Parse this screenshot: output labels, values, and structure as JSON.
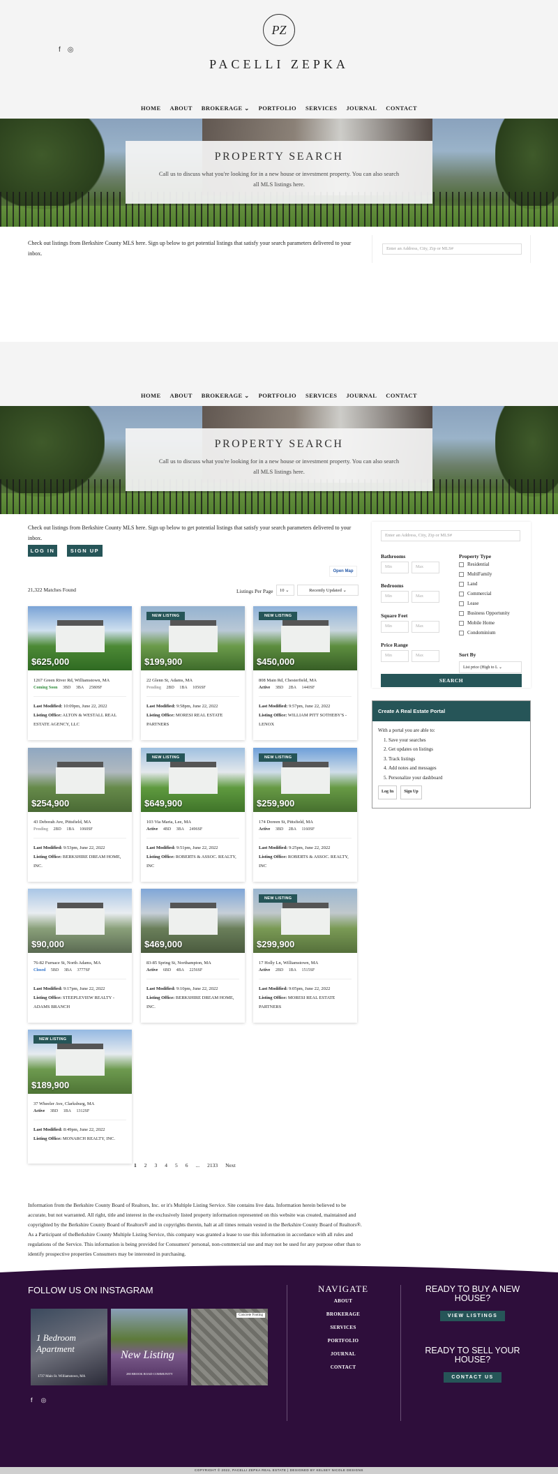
{
  "brand": {
    "logo_monogram": "PZ",
    "name": "PACELLI ZEPKA"
  },
  "social": {
    "facebook": "f",
    "instagram": "◎"
  },
  "nav": [
    "HOME",
    "ABOUT",
    "BROKERAGE ⌄",
    "PORTFOLIO",
    "SERVICES",
    "JOURNAL",
    "CONTACT"
  ],
  "hero": {
    "title": "PROPERTY SEARCH",
    "description": "Call us to discuss what you're looking for in a new house or investment property. You can also search all MLS listings here."
  },
  "intro": "Check out listings from Berkshire County MLS here. Sign up below to get potential listings that satisfy your search parameters delivered to your inbox.",
  "search": {
    "address_placeholder": "Enter an Address, City, Zip or MLS#",
    "bathrooms_label": "Bathrooms",
    "bedrooms_label": "Bedrooms",
    "sqft_label": "Square Feet",
    "price_label": "Price Range",
    "min": "Min",
    "max": "Max",
    "property_type_label": "Property Type",
    "property_types": [
      "Residential",
      "MultiFamily",
      "Land",
      "Commercial",
      "Lease",
      "Business Opportunity",
      "Mobile Home",
      "Condominium"
    ],
    "sort_by_label": "Sort By",
    "sort_by_value": "List price (High to L",
    "search_button": "SEARCH"
  },
  "auth": {
    "login": "LOG IN",
    "signup": "SIGN UP"
  },
  "results": {
    "open_map": "Open Map",
    "matches": "21,322 Matches Found",
    "per_page_label": "Listings Per Page",
    "per_page_value": "10",
    "sort_value": "Recently Updated"
  },
  "listings": [
    {
      "badge": "",
      "price": "$625,000",
      "address": "1267 Green River Rd, Williamstown, MA",
      "status": "Coming Soon",
      "status_color": "#2e8b3a",
      "bd": "3BD",
      "ba": "3BA",
      "sf": "2580SF",
      "modified": "10:09pm, June 22, 2022",
      "office": "ALTON & WESTALL REAL ESTATE AGENCY, LLC"
    },
    {
      "badge": "NEW LISTING",
      "price": "$199,900",
      "address": "22 Glenn St, Adams, MA",
      "status": "Pending",
      "status_color": "#999999",
      "bd": "2BD",
      "ba": "1BA",
      "sf": "1056SF",
      "modified": "9:58pm, June 22, 2022",
      "office": "MORESI REAL ESTATE PARTNERS"
    },
    {
      "badge": "NEW LISTING",
      "price": "$450,000",
      "address": "808 Main Rd, Chesterfield, MA",
      "status": "Active",
      "status_color": "#222222",
      "bd": "3BD",
      "ba": "2BA",
      "sf": "1440SF",
      "modified": "9:57pm, June 22, 2022",
      "office": "WILLIAM PITT SOTHEBY'S - LENOX"
    },
    {
      "badge": "",
      "price": "$254,900",
      "address": "43 Deborah Ave, Pittsfield, MA",
      "status": "Pending",
      "status_color": "#999999",
      "bd": "2BD",
      "ba": "1BA",
      "sf": "1060SF",
      "modified": "9:53pm, June 22, 2022",
      "office": "BERKSHIRE DREAM HOME, INC."
    },
    {
      "badge": "NEW LISTING",
      "price": "$649,900",
      "address": "103 Via Maria, Lee, MA",
      "status": "Active",
      "status_color": "#222222",
      "bd": "4BD",
      "ba": "3BA",
      "sf": "2496SF",
      "modified": "9:51pm, June 22, 2022",
      "office": "ROBERTS & ASSOC. REALTY, INC"
    },
    {
      "badge": "NEW LISTING",
      "price": "$259,900",
      "address": "174 Doreen St, Pittsfield, MA",
      "status": "Active",
      "status_color": "#222222",
      "bd": "3BD",
      "ba": "2BA",
      "sf": "1160SF",
      "modified": "9:25pm, June 22, 2022",
      "office": "ROBERTS & ASSOC. REALTY, INC"
    },
    {
      "badge": "",
      "price": "$90,000",
      "address": "76-82 Furnace St, North Adams, MA",
      "status": "Closed",
      "status_color": "#2a6fc9",
      "bd": "5BD",
      "ba": "3BA",
      "sf": "3777SF",
      "modified": "9:17pm, June 22, 2022",
      "office": "STEEPLEVIEW REALTY - ADAMS BRANCH"
    },
    {
      "badge": "",
      "price": "$469,000",
      "address": "83-85 Spring St, Northampton, MA",
      "status": "Active",
      "status_color": "#222222",
      "bd": "6BD",
      "ba": "4BA",
      "sf": "2256SF",
      "modified": "9:10pm, June 22, 2022",
      "office": "BERKSHIRE DREAM HOME, INC."
    },
    {
      "badge": "NEW LISTING",
      "price": "$299,900",
      "address": "17 Holly Ln, Williamstown, MA",
      "status": "Active",
      "status_color": "#222222",
      "bd": "2BD",
      "ba": "1BA",
      "sf": "1515SF",
      "modified": "9:05pm, June 22, 2022",
      "office": "MORESI REAL ESTATE PARTNERS"
    },
    {
      "badge": "NEW LISTING",
      "price": "$189,900",
      "address": "37 Wheeler Ave, Clarksburg, MA",
      "status": "Active",
      "status_color": "#222222",
      "bd": "3BD",
      "ba": "1BA",
      "sf": "1312SF",
      "modified": "8:49pm, June 22, 2022",
      "office": "MONARCH REALTY, INC."
    }
  ],
  "labels": {
    "last_modified": "Last Modified:",
    "listing_office": "Listing Office:"
  },
  "pagination": [
    "1",
    "2",
    "3",
    "4",
    "5",
    "6",
    "...",
    "2133",
    "Next"
  ],
  "portal": {
    "title": "Create A Real Estate Portal",
    "lead": "With a portal you are able to:",
    "items": [
      "Save your searches",
      "Get updates on listings",
      "Track listings",
      "Add notes and messages",
      "Personalize your dashboard"
    ],
    "login": "Log In",
    "signup": "Sign Up"
  },
  "disclaimer": "Information from the Berkshire County Board of Realtors, Inc. or it's Multiple Listing Service. Site contains live data. Information herein believed to be accurate, but not warranted. All right, title and interest in the exclusively listed property information represented on this website was created, maintained and copyrighted by the Berkshire County Board of Realtors® and in copyrights therein, halt at all times remain vested in the Berkshire County Board of Realtors®. As a Participant of theBerkshire County Multiple Listing Service, this company was granted a lease to use this information in accordance with all rules and regulations of the Service. This information is being provided for Consumers' personal, non-commercial use and may not be used for any purpose other than to identify prospective properties Consumers may be interested in purchasing.",
  "footer": {
    "instagram_title": "FOLLOW US ON INSTAGRAM",
    "insta_posts": [
      {
        "caption": "1 Bedroom Apartment",
        "sub": "1737 Main St. Williamstown, MA"
      },
      {
        "caption": "New Listing",
        "sub": "280 BROOK ROAD COMMUNITY"
      },
      {
        "caption": "Concrete Footing",
        "sub": ""
      }
    ],
    "nav_title": "NAVIGATE",
    "nav_items": [
      "ABOUT",
      "BROKERAGE",
      "SERVICES",
      "PORTFOLIO",
      "JOURNAL",
      "CONTACT"
    ],
    "buy_title": "READY TO BUY A NEW HOUSE?",
    "buy_button": "VIEW LISTINGS",
    "sell_title": "READY TO SELL YOUR HOUSE?",
    "sell_button": "CONTACT US",
    "copyright": "COPYRIGHT © 2022, PACELLI ZEPKA REAL ESTATE | DESIGNED BY KELSEY NICOLE DESIGNS"
  },
  "colors": {
    "accent": "#265558",
    "footer_bg": "#2e0e3b",
    "header_bg": "#f4f4f4"
  }
}
